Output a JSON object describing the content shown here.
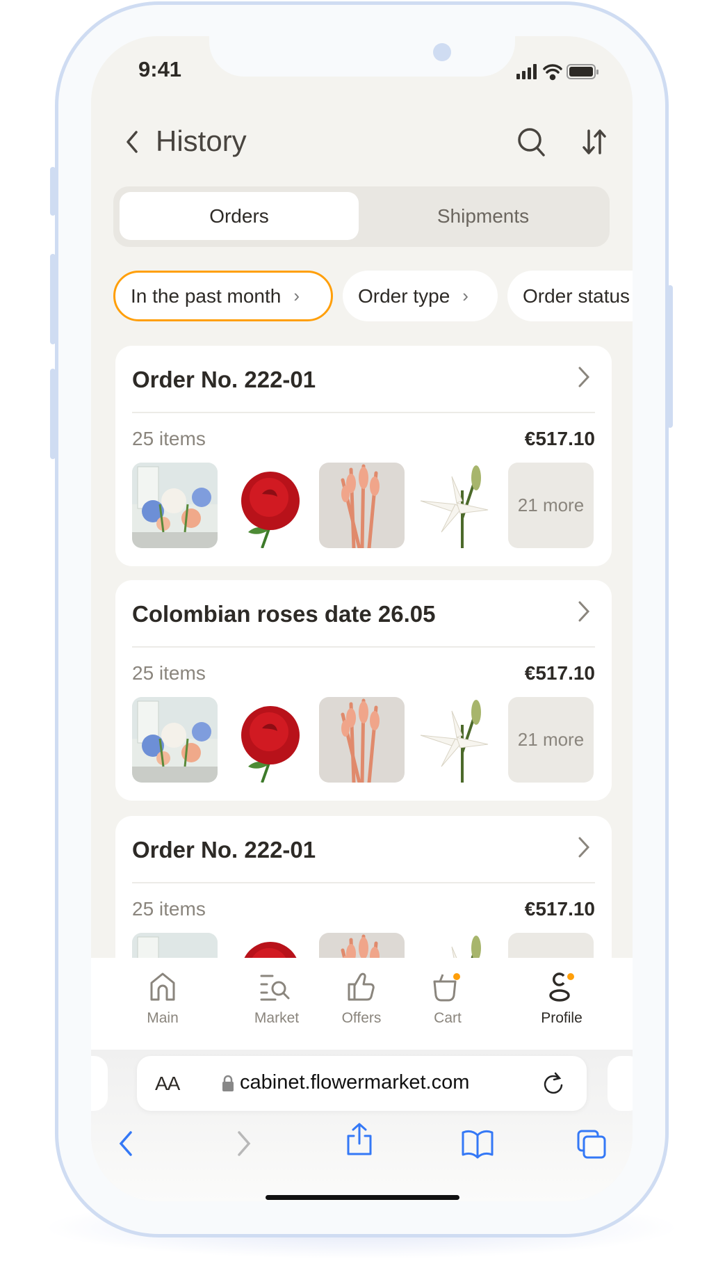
{
  "status_bar": {
    "time": "9:41"
  },
  "header": {
    "title": "History",
    "back_icon": "chevron-left-icon",
    "search_icon": "search-icon",
    "sort_icon": "sort-icon"
  },
  "segments": [
    {
      "label": "Orders",
      "active": true
    },
    {
      "label": "Shipments",
      "active": false
    }
  ],
  "filters": [
    {
      "label": "In the past month",
      "active": true
    },
    {
      "label": "Order type",
      "active": false
    },
    {
      "label": "Order status",
      "active": false
    }
  ],
  "orders": [
    {
      "title": "Order No. 222-01",
      "items": "25 items",
      "price": "€517.10",
      "more": "21 more"
    },
    {
      "title": "Colombian roses date 26.05",
      "items": "25 items",
      "price": "€517.10",
      "more": "21 more"
    },
    {
      "title": "Order No. 222-01",
      "items": "25 items",
      "price": "€517.10",
      "more": ""
    }
  ],
  "tabbar": [
    {
      "label": "Main",
      "icon": "home-icon"
    },
    {
      "label": "Market",
      "icon": "market-search-icon"
    },
    {
      "label": "Offers",
      "icon": "thumbs-up-icon"
    },
    {
      "label": "Cart",
      "icon": "cart-icon",
      "badge": true
    },
    {
      "label": "Profile",
      "icon": "profile-icon",
      "badge": true,
      "active": true
    }
  ],
  "browser": {
    "text_size": "AA",
    "url": "cabinet.flowermarket.com"
  },
  "colors": {
    "accent": "#FF9F0A",
    "browser_blue": "#3478F6",
    "background": "#F4F3EF",
    "text": "#2D2A26",
    "muted": "#8A857D"
  }
}
